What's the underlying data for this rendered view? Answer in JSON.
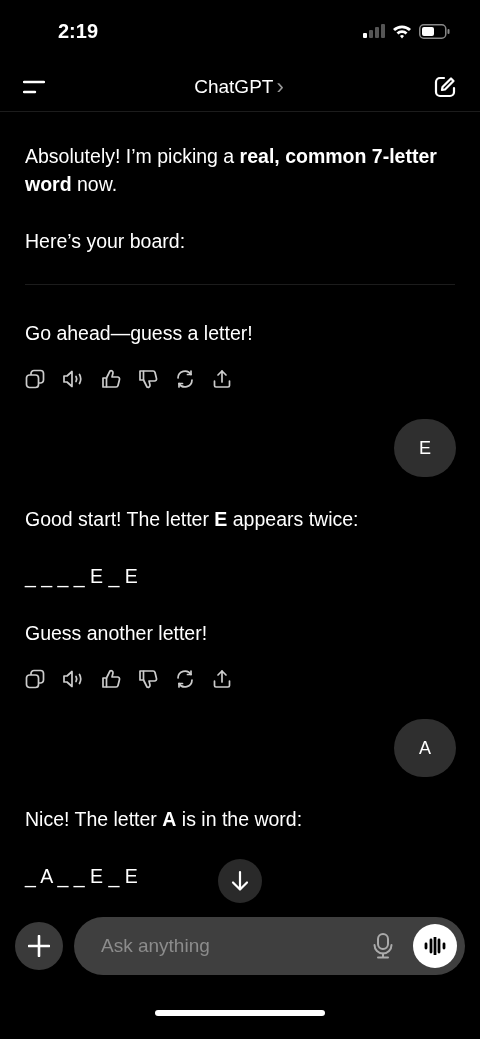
{
  "status_bar": {
    "time": "2:19"
  },
  "header": {
    "title": "ChatGPT",
    "chevron": "›"
  },
  "messages": [
    {
      "kind": "assistant",
      "blocks": [
        {
          "kind": "text",
          "text": "Absolutely! I’m picking a **real, common 7-letter word** now."
        },
        {
          "kind": "text",
          "text": "Here’s your board:"
        },
        {
          "kind": "rule"
        },
        {
          "kind": "text",
          "text": "Go ahead—guess a letter!"
        }
      ],
      "actions": true
    },
    {
      "kind": "user",
      "text": "E"
    },
    {
      "kind": "assistant",
      "blocks": [
        {
          "kind": "text",
          "text": "Good start! The letter **E** appears twice:"
        },
        {
          "kind": "board",
          "text": "_ _ _ _ E _ E"
        },
        {
          "kind": "text",
          "text": "Guess another letter!"
        }
      ],
      "actions": true
    },
    {
      "kind": "user",
      "text": "A"
    },
    {
      "kind": "assistant",
      "blocks": [
        {
          "kind": "text",
          "text": "Nice! The letter **A** is in the word:"
        },
        {
          "kind": "board",
          "text": "_ A _ _ E _ E"
        }
      ],
      "actions": false
    }
  ],
  "composer": {
    "placeholder": "Ask anything"
  }
}
